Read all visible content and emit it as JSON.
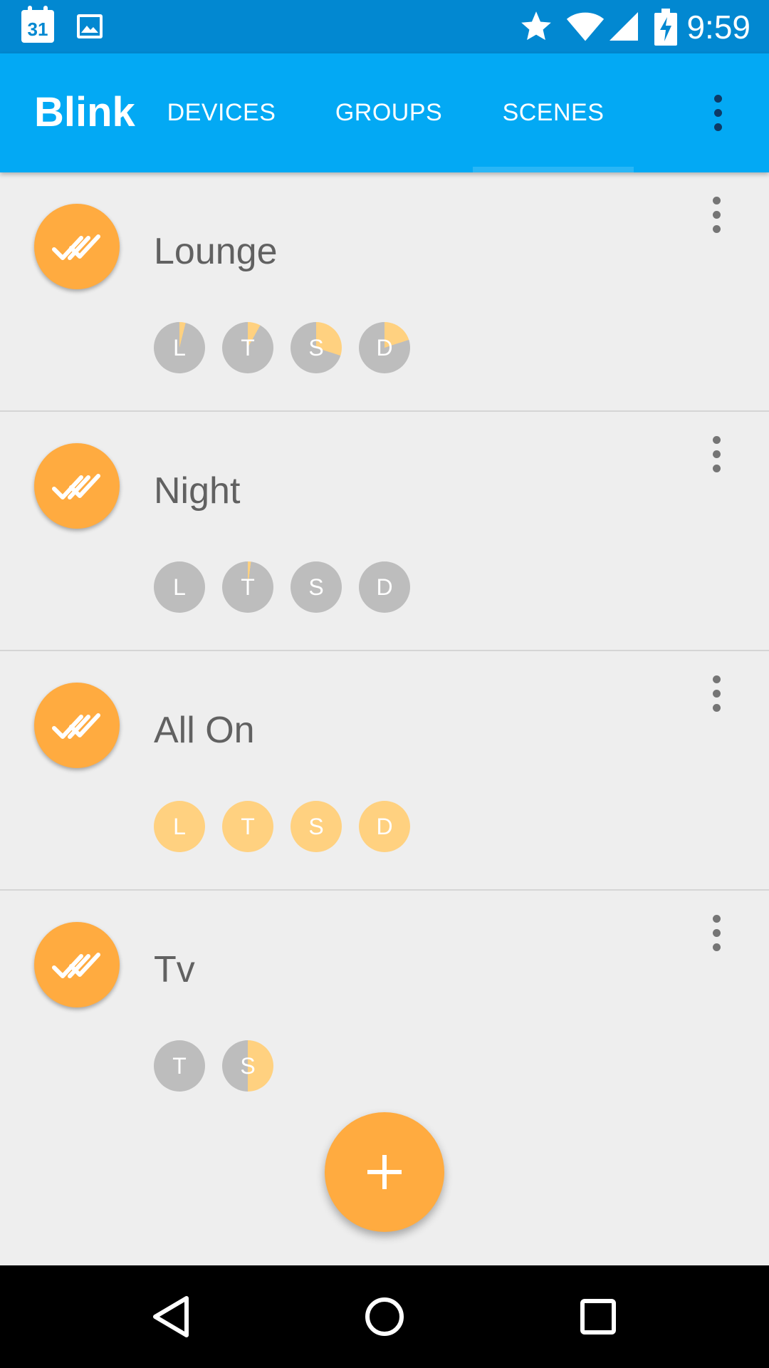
{
  "status_bar": {
    "calendar_day": "31",
    "time": "9:59",
    "icons": [
      "calendar-icon",
      "image-icon",
      "star-icon",
      "wifi-icon",
      "signal-icon",
      "battery-charging-icon"
    ]
  },
  "app_bar": {
    "title": "Blink",
    "tabs": [
      {
        "label": "DEVICES",
        "selected": false
      },
      {
        "label": "GROUPS",
        "selected": false
      },
      {
        "label": "SCENES",
        "selected": true
      }
    ],
    "overflow_icon": "more-vert-icon"
  },
  "colors": {
    "status_bar": "#0288d1",
    "app_bar": "#03a9f4",
    "accent": "#ffab40",
    "device_off": "#bdbdbd",
    "device_on": "#ffd180",
    "background": "#eeeeee"
  },
  "scenes": [
    {
      "name": "Lounge",
      "devices": [
        {
          "label": "L",
          "level": 0.04
        },
        {
          "label": "T",
          "level": 0.08
        },
        {
          "label": "S",
          "level": 0.3
        },
        {
          "label": "D",
          "level": 0.2
        }
      ]
    },
    {
      "name": "Night",
      "devices": [
        {
          "label": "L",
          "level": 0
        },
        {
          "label": "T",
          "level": 0.02
        },
        {
          "label": "S",
          "level": 0
        },
        {
          "label": "D",
          "level": 0
        }
      ]
    },
    {
      "name": "All On",
      "devices": [
        {
          "label": "L",
          "level": 1
        },
        {
          "label": "T",
          "level": 1
        },
        {
          "label": "S",
          "level": 1
        },
        {
          "label": "D",
          "level": 1
        }
      ]
    },
    {
      "name": "Tv",
      "devices": [
        {
          "label": "T",
          "level": 0
        },
        {
          "label": "S",
          "level": 0.5
        }
      ]
    }
  ],
  "fab": {
    "icon": "add-icon"
  },
  "nav_bar": {
    "icons": [
      "back-icon",
      "home-icon",
      "recents-icon"
    ]
  }
}
